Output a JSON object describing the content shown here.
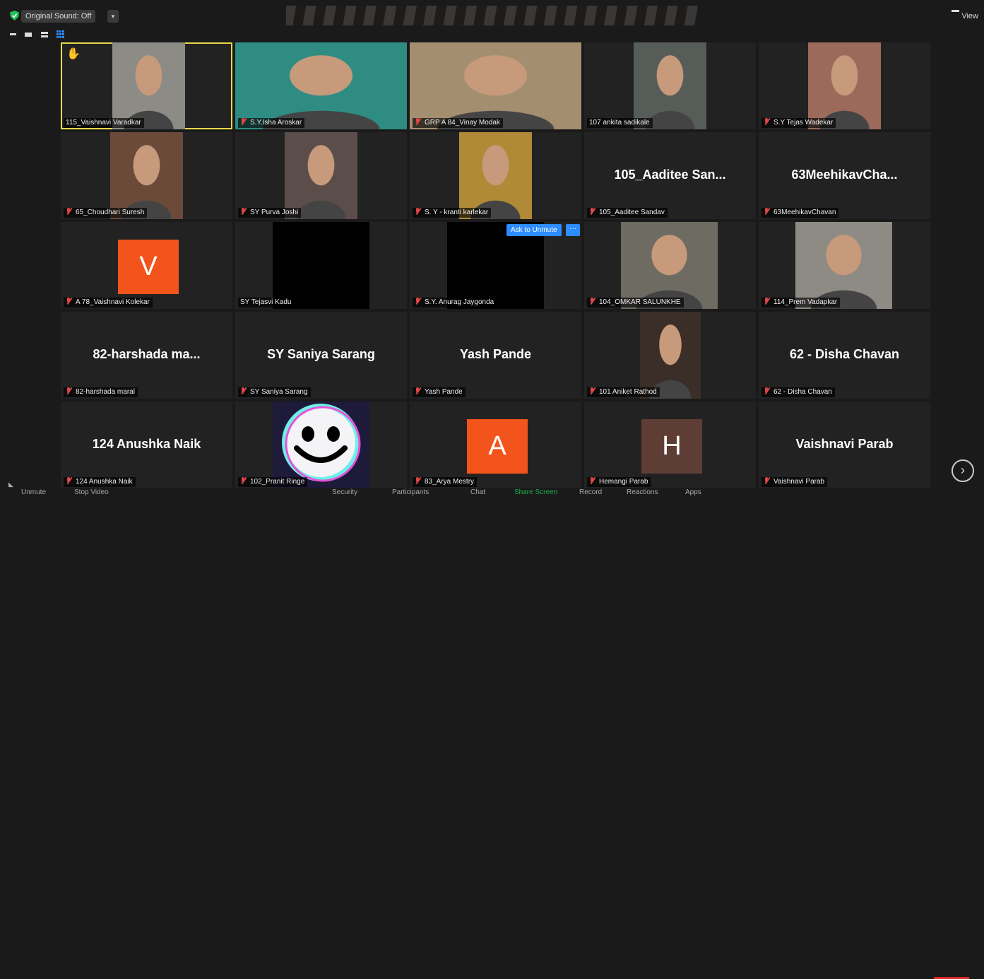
{
  "topbar": {
    "original_sound": "Original Sound: Off",
    "caret": "▾",
    "view_label": "View"
  },
  "participants": [
    {
      "name": "115_Vaishnavi Varadkar",
      "muted": false,
      "hand": true,
      "active": true,
      "video": "photo",
      "bg": "#8d8b86"
    },
    {
      "name": "S.Y.Isha Aroskar",
      "muted": true,
      "video": "photo",
      "bg": "#2e8c82"
    },
    {
      "name": "GRP A 84_Vinay Modak",
      "muted": true,
      "video": "photo",
      "bg": "#a48e70"
    },
    {
      "name": "107 ankita sadikale",
      "muted": false,
      "video": "photo",
      "bg": "#565d58"
    },
    {
      "name": "S.Y Tejas Wadekar",
      "muted": true,
      "video": "photo",
      "bg": "#9b6a5a"
    },
    {
      "name": "65_Choudhari Suresh",
      "muted": true,
      "video": "photo",
      "bg": "#6b4a3a"
    },
    {
      "name": "SY Purva Joshi",
      "muted": true,
      "video": "photo",
      "bg": "#5b4e4a"
    },
    {
      "name": "S. Y - kranti karlekar",
      "muted": true,
      "video": "photo",
      "bg": "#b08a36"
    },
    {
      "name": "105_Aaditee Sandav",
      "display": "105_Aaditee  San...",
      "muted": true,
      "video": "none"
    },
    {
      "name": "63MeehikavChavan",
      "display": "63MeehikavCha...",
      "muted": true,
      "video": "none"
    },
    {
      "name": "A 78_Vaishnavi Kolekar",
      "muted": true,
      "video": "avatar",
      "letter": "V",
      "color": "#f2541b"
    },
    {
      "name": "SY Tejasvi Kadu",
      "muted": false,
      "video": "black"
    },
    {
      "name": "S.Y. Anurag Jaygonda",
      "muted": true,
      "video": "black"
    },
    {
      "name": "104_OMKAR SALUNKHE",
      "muted": true,
      "video": "photo",
      "bg": "#6e6b62"
    },
    {
      "name": "114_Prem Vadapkar",
      "muted": true,
      "video": "photo",
      "bg": "#8e8a84"
    },
    {
      "name": "82-harshada maral",
      "display": "82-harshada  ma...",
      "muted": true,
      "video": "none"
    },
    {
      "name": "SY  Saniya Sarang",
      "display": "SY  Saniya Sarang",
      "muted": true,
      "video": "none"
    },
    {
      "name": "Yash Pande",
      "display": "Yash Pande",
      "muted": true,
      "video": "none"
    },
    {
      "name": "101 Aniket Rathod",
      "muted": true,
      "video": "photo",
      "bg": "#3b2e28"
    },
    {
      "name": "62 - Disha Chavan",
      "display": "62 - Disha Chavan",
      "muted": true,
      "video": "none"
    },
    {
      "name": "124 Anushka Naik",
      "display": "124 Anushka Naik",
      "muted": true,
      "video": "none"
    },
    {
      "name": "102_Pranit Ringe",
      "muted": true,
      "video": "smiley"
    },
    {
      "name": "83_Arya Mestry",
      "muted": true,
      "video": "avatar",
      "letter": "A",
      "color": "#f2541b"
    },
    {
      "name": "Hemangi Parab",
      "muted": true,
      "video": "avatar",
      "letter": "H",
      "color": "#5e3d35"
    },
    {
      "name": "Vaishnavi Parab",
      "display": "Vaishnavi Parab",
      "muted": true,
      "video": "none"
    }
  ],
  "ask_unmute": {
    "label": "Ask to Unmute",
    "more": "···"
  },
  "bottombar": {
    "unmute": "Unmute",
    "stop_video": "Stop Video",
    "security": "Security",
    "participants": "Participants",
    "chat": "Chat",
    "share_screen": "Share Screen",
    "record": "Record",
    "reactions": "Reactions",
    "apps": "Apps"
  },
  "colors": {
    "active_speaker": "#e6d84a",
    "accent": "#2d8cff",
    "share_green": "#19b34a",
    "muted_red": "#e04646"
  }
}
